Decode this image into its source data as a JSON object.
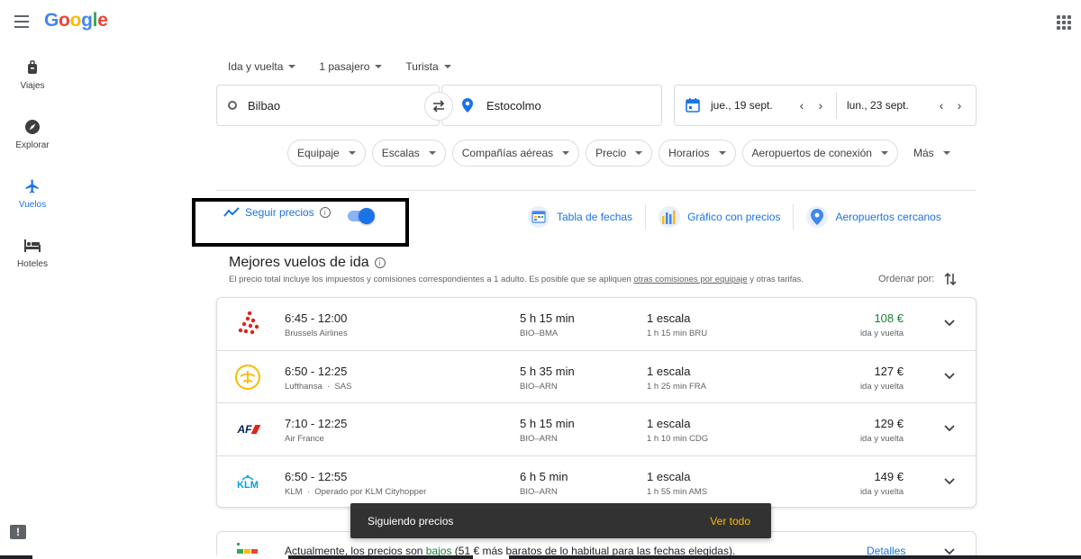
{
  "brand": {
    "logo_letters": [
      "G",
      "o",
      "o",
      "g",
      "l",
      "e"
    ]
  },
  "leftnav": {
    "items": [
      {
        "label": "Viajes",
        "icon": "luggage-icon"
      },
      {
        "label": "Explorar",
        "icon": "compass-icon"
      },
      {
        "label": "Vuelos",
        "icon": "airplane-icon"
      },
      {
        "label": "Hoteles",
        "icon": "bed-icon"
      }
    ]
  },
  "search": {
    "trip_type": "Ida y vuelta",
    "passengers": "1 pasajero",
    "cabin": "Turista",
    "origin": "Bilbao",
    "destination": "Estocolmo",
    "depart_date": "jue., 19 sept.",
    "return_date": "lun., 23 sept."
  },
  "filters": {
    "chips": [
      "Equipaje",
      "Escalas",
      "Compañías aéreas",
      "Precio",
      "Horarios",
      "Aeropuertos de conexión"
    ],
    "more": "Más"
  },
  "tracking": {
    "label": "Seguir precios",
    "enabled": true
  },
  "tools": {
    "date_grid": "Tabla de fechas",
    "price_graph": "Gráfico con precios",
    "nearby": "Aeropuertos cercanos"
  },
  "results": {
    "title": "Mejores vuelos de ida",
    "disclaimer_pre": "El precio total incluye los impuestos y comisiones correspondientes a 1 adulto. Es posible que se apliquen ",
    "disclaimer_link": "otras comisiones por equipaje",
    "disclaimer_post": " y otras tarifas.",
    "sort_label": "Ordenar por:",
    "flights": [
      {
        "times": "6:45 - 12:00",
        "airline": "Brussels Airlines",
        "duration": "5 h 15 min",
        "route": "BIO–BMA",
        "stops": "1 escala",
        "layover": "1 h 15 min BRU",
        "price": "108 €",
        "price_type": "ida y vuelta",
        "low": true
      },
      {
        "times": "6:50 - 12:25",
        "airline": "Lufthansa  ·  SAS",
        "duration": "5 h 35 min",
        "route": "BIO–ARN",
        "stops": "1 escala",
        "layover": "1 h 25 min FRA",
        "price": "127 €",
        "price_type": "ida y vuelta",
        "low": false
      },
      {
        "times": "7:10 - 12:25",
        "airline": "Air France",
        "duration": "5 h 15 min",
        "route": "BIO–ARN",
        "stops": "1 escala",
        "layover": "1 h 10 min CDG",
        "price": "129 €",
        "price_type": "ida y vuelta",
        "low": false
      },
      {
        "times": "6:50 - 12:55",
        "airline": "KLM  ·  Operado por KLM Cityhopper",
        "duration": "6 h 5 min",
        "route": "BIO–ARN",
        "stops": "1 escala",
        "layover": "1 h 55 min AMS",
        "price": "149 €",
        "price_type": "ida y vuelta",
        "low": false
      }
    ]
  },
  "insight": {
    "pre": "Actualmente, los precios son ",
    "level": "bajos",
    "post": " (51 € más baratos de lo habitual para las fechas elegidas).",
    "details": "Detalles"
  },
  "snackbar": {
    "text": "Siguiendo precios",
    "action": "Ver todo"
  },
  "airline_logos": {
    "af": "AF",
    "klm": "KLM"
  },
  "colors": {
    "accent": "#1a73e8",
    "low_price": "#188038",
    "snackbar_bg": "#323232",
    "snackbar_action": "#fbbc04"
  }
}
